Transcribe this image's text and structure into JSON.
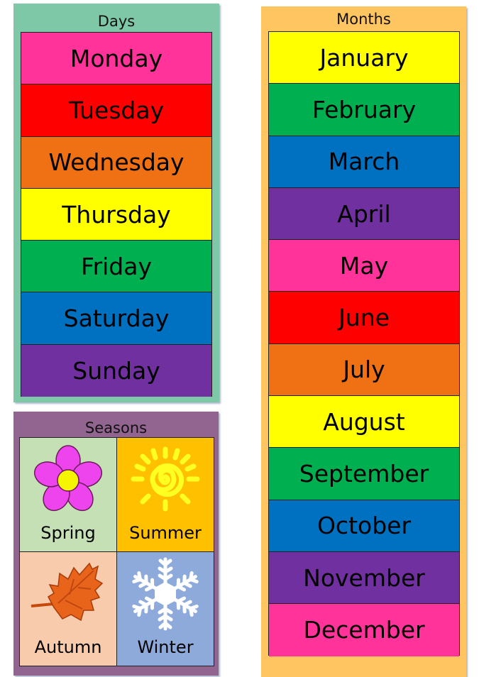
{
  "days": {
    "title": "Days",
    "background": "#7ec8a8",
    "items": [
      {
        "label": "Monday",
        "color": "#ff3399"
      },
      {
        "label": "Tuesday",
        "color": "#ff0000"
      },
      {
        "label": "Wednesday",
        "color": "#f07014"
      },
      {
        "label": "Thursday",
        "color": "#ffff00"
      },
      {
        "label": "Friday",
        "color": "#00b050"
      },
      {
        "label": "Saturday",
        "color": "#0070c0"
      },
      {
        "label": "Sunday",
        "color": "#7030a0"
      }
    ]
  },
  "months": {
    "title": "Months",
    "background": "#ffc560",
    "items": [
      {
        "label": "January",
        "color": "#ffff00"
      },
      {
        "label": "February",
        "color": "#00b050"
      },
      {
        "label": "March",
        "color": "#0070c0"
      },
      {
        "label": "April",
        "color": "#7030a0"
      },
      {
        "label": "May",
        "color": "#ff3399"
      },
      {
        "label": "June",
        "color": "#ff0000"
      },
      {
        "label": "July",
        "color": "#f07014"
      },
      {
        "label": "August",
        "color": "#ffff00"
      },
      {
        "label": "September",
        "color": "#00b050"
      },
      {
        "label": "October",
        "color": "#0070c0"
      },
      {
        "label": "November",
        "color": "#7030a0"
      },
      {
        "label": "December",
        "color": "#ff3399"
      }
    ]
  },
  "seasons": {
    "title": "Seasons",
    "background": "#926490",
    "items": [
      {
        "label": "Spring",
        "color": "#c4e0b4",
        "icon": "flower-icon"
      },
      {
        "label": "Summer",
        "color": "#ffc000",
        "icon": "sun-icon"
      },
      {
        "label": "Autumn",
        "color": "#f7cbac",
        "icon": "leaf-icon"
      },
      {
        "label": "Winter",
        "color": "#8eaadb",
        "icon": "snowflake-icon"
      }
    ]
  }
}
